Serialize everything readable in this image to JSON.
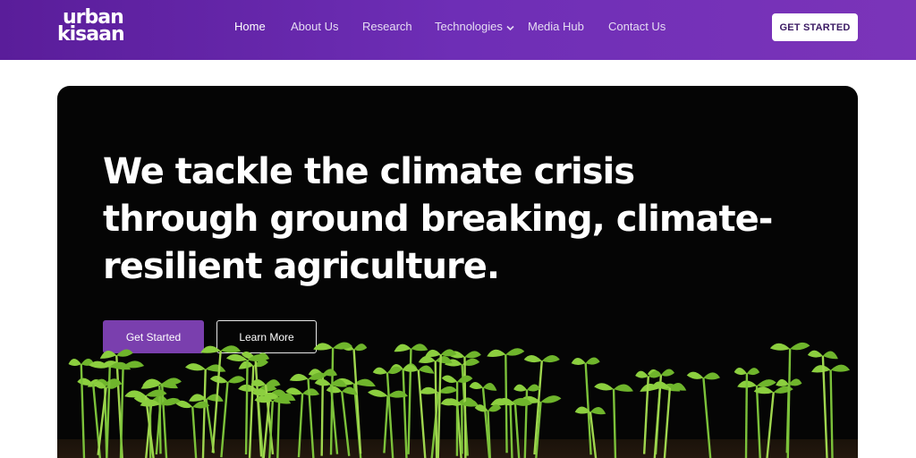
{
  "header": {
    "logo": {
      "line1": "urban",
      "line2": "kisaan"
    },
    "nav": [
      {
        "label": "Home",
        "active": true
      },
      {
        "label": "About Us"
      },
      {
        "label": "Research"
      },
      {
        "label": "Technologies",
        "has_dropdown": true
      },
      {
        "label": "Media Hub"
      },
      {
        "label": "Contact Us"
      }
    ],
    "cta_label": "GET STARTED"
  },
  "hero": {
    "headline": "We tackle the climate crisis through ground breaking, climate-resilient agriculture.",
    "primary_button": "Get Started",
    "secondary_button": "Learn More",
    "image": "seedlings-in-soil"
  },
  "colors": {
    "header_gradient_start": "#5a1d9a",
    "header_gradient_end": "#7b34b9",
    "primary_button": "#7a3fae",
    "hero_background": "#050505",
    "sprout_green": "#7cc23a"
  }
}
